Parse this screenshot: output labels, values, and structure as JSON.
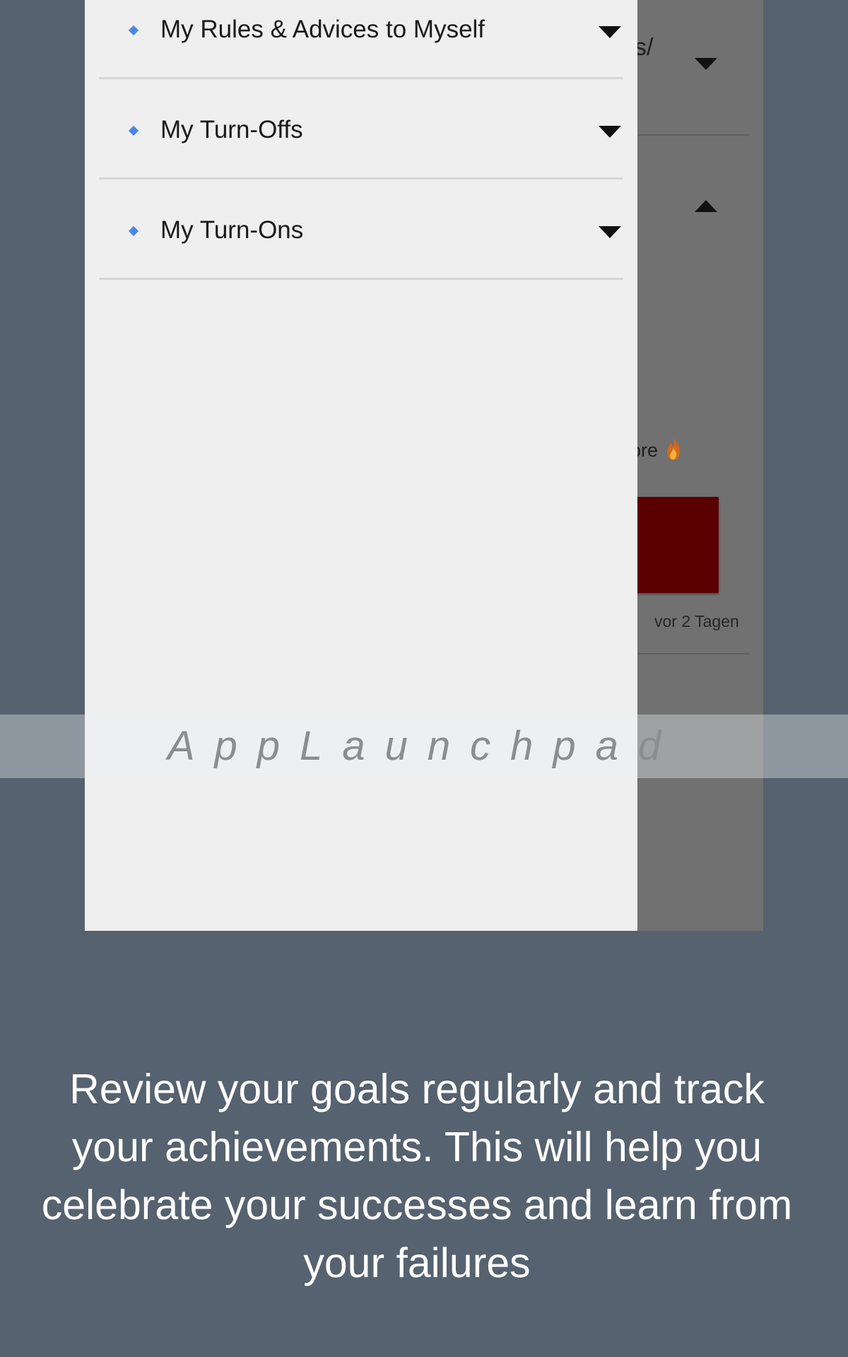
{
  "background_screen": {
    "top_text": "s/",
    "more_text": "ore",
    "flame_icon": "fire-emoji",
    "card_color": "#5b0000",
    "date_text": "vor 2 Tagen"
  },
  "drawer": {
    "bullet_icon": "blue-diamond-icon",
    "bullet_color": "#4a86e8",
    "items": [
      {
        "label": "My Rules & Advices to Myself",
        "expanded": false
      },
      {
        "label": "My Turn-Offs",
        "expanded": false
      },
      {
        "label": "My Turn-Ons",
        "expanded": false
      }
    ]
  },
  "watermark": {
    "text": "AppLaunchpad"
  },
  "caption": {
    "text": "Review your goals regularly and track your achievements. This will help you celebrate your successes and learn from your failures"
  },
  "colors": {
    "page_background": "#56626f",
    "drawer_background": "#efefef",
    "caption_text": "#ffffff"
  }
}
